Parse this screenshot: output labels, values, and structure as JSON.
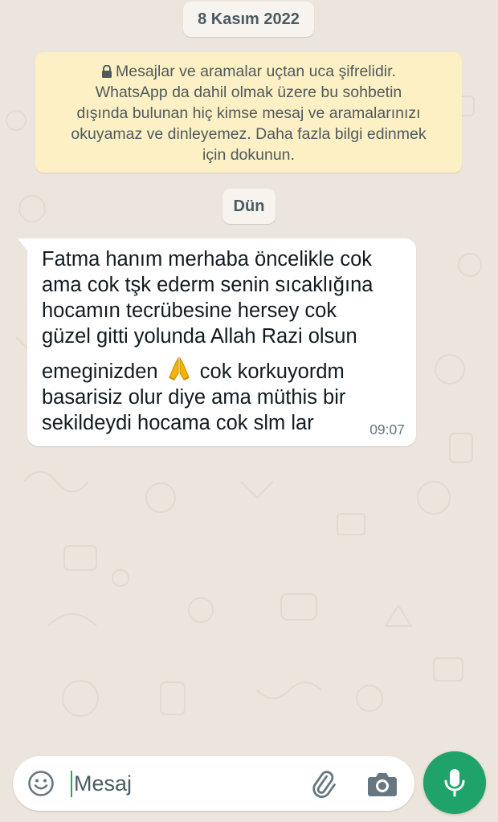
{
  "chat": {
    "date_chip": "8 Kasım 2022",
    "encryption_notice": {
      "lines": [
        "Mesajlar ve aramalar uçtan uca şifrelidir.",
        "WhatsApp da dahil olmak üzere bu sohbetin",
        "dışında bulunan hiç kimse mesaj ve aramalarınızı",
        "okuyamaz ve dinleyemez. Daha fazla bilgi edinmek",
        "için dokunun."
      ]
    },
    "day_chip": "Dün",
    "message": {
      "lines": [
        "Fatma hanım merhaba öncelikle cok",
        "ama cok tşk ederm senin sıcaklığına",
        "hocamın tecrübesine hersey cok",
        "güzel gitti yolunda Allah Razi olsun"
      ],
      "emoji_line_before": "emeginizden",
      "emoji_line_after": "cok korkuyordm",
      "lines_after": [
        "basarisiz olur diye ama müthis bir",
        "sekildeydi hocama cok slm lar"
      ],
      "time": "09:07"
    }
  },
  "composer": {
    "placeholder": "Mesaj"
  },
  "icons": {
    "emoji": "emoji-icon",
    "attach": "paperclip-icon",
    "camera": "camera-icon",
    "mic": "microphone-icon",
    "lock": "lock-icon",
    "pray": "folded-hands-emoji"
  },
  "colors": {
    "wallpaper": "#ece5dd",
    "notice_background": "#fdf0c4",
    "bubble": "#ffffff",
    "accent_green": "#1fa36b",
    "time_text": "#667781"
  }
}
